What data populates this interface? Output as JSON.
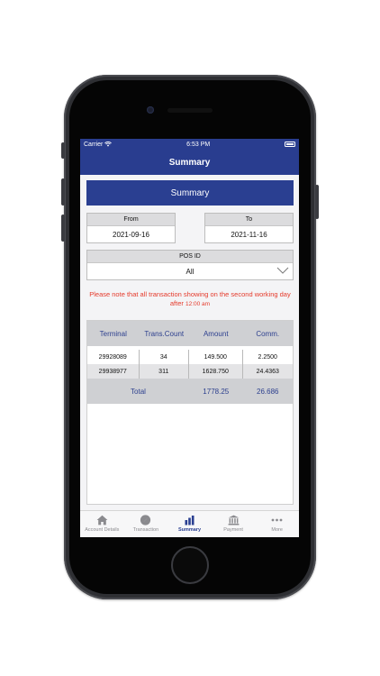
{
  "status_bar": {
    "carrier": "Carrier",
    "time": "6:53 PM"
  },
  "nav": {
    "title": "Summary"
  },
  "banner": {
    "title": "Summary"
  },
  "filters": {
    "from_label": "From",
    "from_value": "2021-09-16",
    "to_label": "To",
    "to_value": "2021-11-16",
    "pos_label": "POS ID",
    "pos_value": "All"
  },
  "notice": {
    "text": "Please note that all transaction showing on the second working day after ",
    "time": "12:00 am"
  },
  "table": {
    "headers": [
      "Terminal",
      "Trans.Count",
      "Amount",
      "Comm."
    ],
    "rows": [
      [
        "29928089",
        "34",
        "149.500",
        "2.2500"
      ],
      [
        "29938977",
        "311",
        "1628.750",
        "24.4363"
      ]
    ],
    "total_label": "Total",
    "total_amount": "1778.25",
    "total_comm": "26.686"
  },
  "tabs": [
    {
      "label": "Account Details",
      "icon": "home-icon"
    },
    {
      "label": "Transaction",
      "icon": "compass-icon"
    },
    {
      "label": "Summary",
      "icon": "bar-chart-icon",
      "active": true
    },
    {
      "label": "Payment",
      "icon": "bank-icon"
    },
    {
      "label": "More",
      "icon": "more-icon"
    }
  ],
  "colors": {
    "primary": "#2a3f91",
    "notice": "#e53a2b",
    "header_gray": "#cfd0d3"
  }
}
